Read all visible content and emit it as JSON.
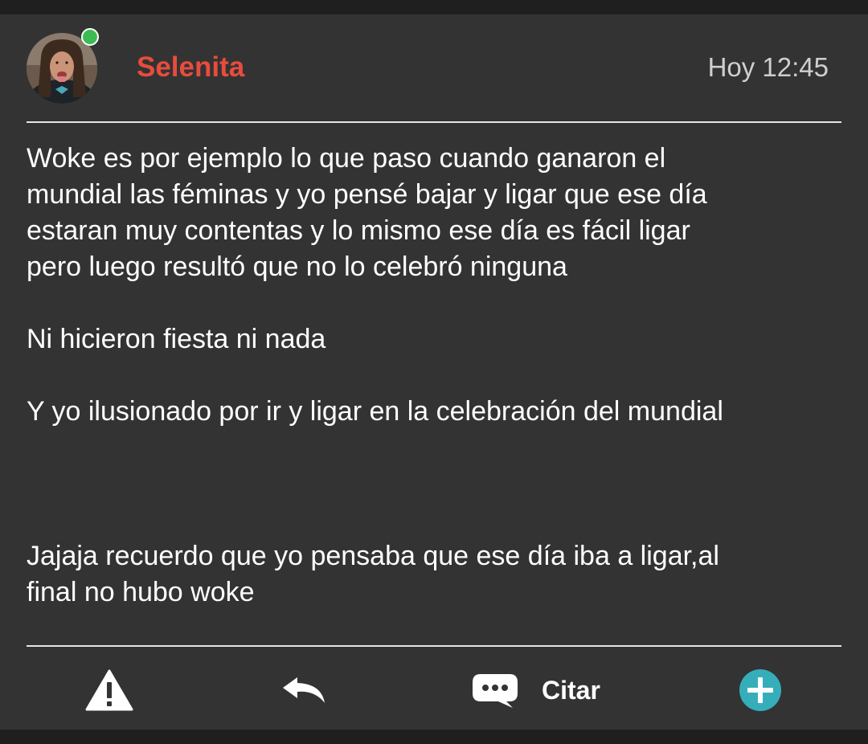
{
  "post": {
    "username": "Selenita",
    "username_color": "#e84c3d",
    "timestamp": "Hoy 12:45",
    "online_status_color": "#3dbb53",
    "message": {
      "paragraph_1": [
        "Woke es por ejemplo lo que paso cuando ganaron el",
        "mundial las féminas y yo pensé bajar y ligar que ese día",
        "estaran muy contentas y lo mismo ese día es fácil ligar",
        "pero luego resultó que no lo celebró ninguna"
      ],
      "paragraph_2": "Ni hicieron fiesta ni nada",
      "paragraph_3": "Y yo ilusionado por ir y ligar en la celebración del mundial",
      "paragraph_4": [
        "Jajaja recuerdo que yo pensaba que ese día iba a ligar,al",
        "final no hubo woke"
      ]
    }
  },
  "actions": {
    "report_icon": "warning-triangle-icon",
    "reply_icon": "reply-arrow-icon",
    "quote_icon": "chat-bubble-icon",
    "quote_label": "Citar",
    "add_icon": "plus-circle-icon",
    "add_color": "#35aeba"
  }
}
